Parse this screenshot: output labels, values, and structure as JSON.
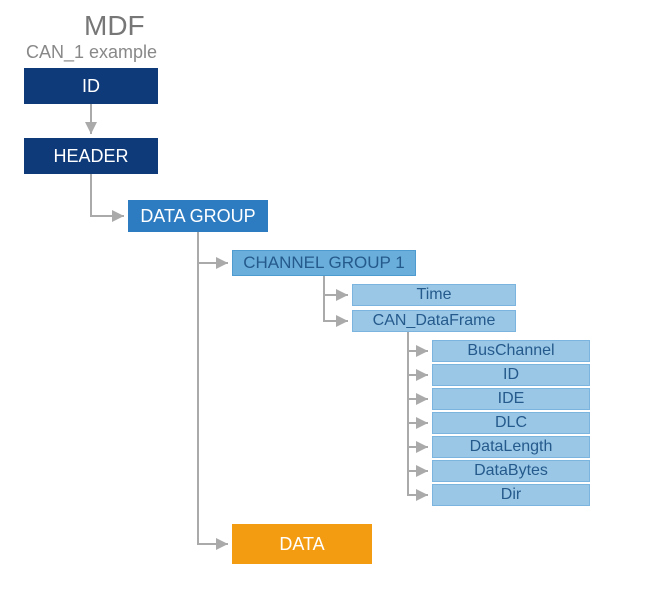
{
  "title": "MDF",
  "subtitle": "CAN_1 example",
  "nodes": {
    "id": "ID",
    "header": "HEADER",
    "dataGroup": "DATA GROUP",
    "channelGroup": "CHANNEL GROUP 1",
    "time": "Time",
    "canDataFrame": "CAN_DataFrame",
    "busChannel": "BusChannel",
    "id2": "ID",
    "ide": "IDE",
    "dlc": "DLC",
    "dataLength": "DataLength",
    "dataBytes": "DataBytes",
    "dir": "Dir",
    "data": "DATA"
  }
}
